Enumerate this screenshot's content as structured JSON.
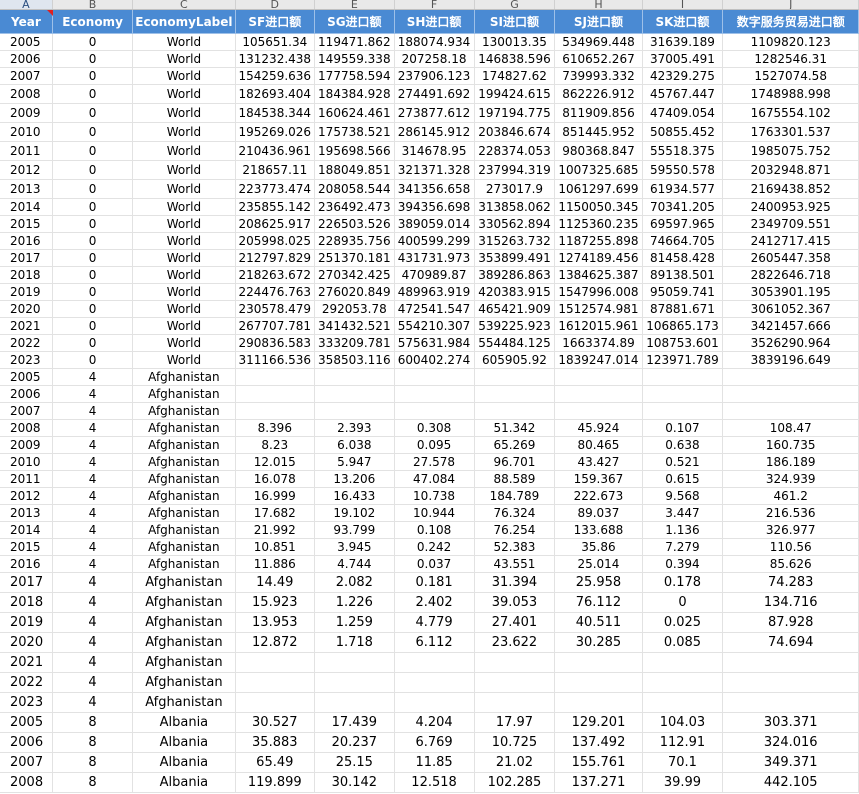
{
  "column_letters": [
    "A",
    "B",
    "C",
    "D",
    "E",
    "F",
    "G",
    "H",
    "I",
    "J"
  ],
  "headers": [
    "Year",
    "Economy",
    "EconomyLabel",
    "SF进口额",
    "SG进口额",
    "SH进口额",
    "SI进口额",
    "SJ进口额",
    "SK进口额",
    "数字服务贸易进口额"
  ],
  "rows": [
    [
      "2005",
      "0",
      "World",
      "105651.34",
      "119471.862",
      "188074.934",
      "130013.35",
      "534969.448",
      "31639.189",
      "1109820.123"
    ],
    [
      "2006",
      "0",
      "World",
      "131232.438",
      "149559.338",
      "207258.18",
      "146838.596",
      "610652.267",
      "37005.491",
      "1282546.31"
    ],
    [
      "2007",
      "0",
      "World",
      "154259.636",
      "177758.594",
      "237906.123",
      "174827.62",
      "739993.332",
      "42329.275",
      "1527074.58"
    ],
    [
      "2008",
      "0",
      "World",
      "182693.404",
      "184384.928",
      "274491.692",
      "199424.615",
      "862226.912",
      "45767.447",
      "1748988.998"
    ],
    [
      "2009",
      "0",
      "World",
      "184538.344",
      "160624.461",
      "273877.612",
      "197194.775",
      "811909.856",
      "47409.054",
      "1675554.102"
    ],
    [
      "2010",
      "0",
      "World",
      "195269.026",
      "175738.521",
      "286145.912",
      "203846.674",
      "851445.952",
      "50855.452",
      "1763301.537"
    ],
    [
      "2011",
      "0",
      "World",
      "210436.961",
      "195698.566",
      "314678.95",
      "228374.053",
      "980368.847",
      "55518.375",
      "1985075.752"
    ],
    [
      "2012",
      "0",
      "World",
      "218657.11",
      "188049.851",
      "321371.328",
      "237994.319",
      "1007325.685",
      "59550.578",
      "2032948.871"
    ],
    [
      "2013",
      "0",
      "World",
      "223773.474",
      "208058.544",
      "341356.658",
      "273017.9",
      "1061297.699",
      "61934.577",
      "2169438.852"
    ],
    [
      "2014",
      "0",
      "World",
      "235855.142",
      "236492.473",
      "394356.698",
      "313858.062",
      "1150050.345",
      "70341.205",
      "2400953.925"
    ],
    [
      "2015",
      "0",
      "World",
      "208625.917",
      "226503.526",
      "389059.014",
      "330562.894",
      "1125360.235",
      "69597.965",
      "2349709.551"
    ],
    [
      "2016",
      "0",
      "World",
      "205998.025",
      "228935.756",
      "400599.299",
      "315263.732",
      "1187255.898",
      "74664.705",
      "2412717.415"
    ],
    [
      "2017",
      "0",
      "World",
      "212797.829",
      "251370.181",
      "431731.973",
      "353899.491",
      "1274189.456",
      "81458.428",
      "2605447.358"
    ],
    [
      "2018",
      "0",
      "World",
      "218263.672",
      "270342.425",
      "470989.87",
      "389286.863",
      "1384625.387",
      "89138.501",
      "2822646.718"
    ],
    [
      "2019",
      "0",
      "World",
      "224476.763",
      "276020.849",
      "489963.919",
      "420383.915",
      "1547996.008",
      "95059.741",
      "3053901.195"
    ],
    [
      "2020",
      "0",
      "World",
      "230578.479",
      "292053.78",
      "472541.547",
      "465421.909",
      "1512574.981",
      "87881.671",
      "3061052.367"
    ],
    [
      "2021",
      "0",
      "World",
      "267707.781",
      "341432.521",
      "554210.307",
      "539225.923",
      "1612015.961",
      "106865.173",
      "3421457.666"
    ],
    [
      "2022",
      "0",
      "World",
      "290836.583",
      "333209.781",
      "575631.984",
      "554484.125",
      "1663374.89",
      "108753.601",
      "3526290.964"
    ],
    [
      "2023",
      "0",
      "World",
      "311166.536",
      "358503.116",
      "600402.274",
      "605905.92",
      "1839247.014",
      "123971.789",
      "3839196.649"
    ],
    [
      "2005",
      "4",
      "Afghanistan",
      "",
      "",
      "",
      "",
      "",
      "",
      ""
    ],
    [
      "2006",
      "4",
      "Afghanistan",
      "",
      "",
      "",
      "",
      "",
      "",
      ""
    ],
    [
      "2007",
      "4",
      "Afghanistan",
      "",
      "",
      "",
      "",
      "",
      "",
      ""
    ],
    [
      "2008",
      "4",
      "Afghanistan",
      "8.396",
      "2.393",
      "0.308",
      "51.342",
      "45.924",
      "0.107",
      "108.47"
    ],
    [
      "2009",
      "4",
      "Afghanistan",
      "8.23",
      "6.038",
      "0.095",
      "65.269",
      "80.465",
      "0.638",
      "160.735"
    ],
    [
      "2010",
      "4",
      "Afghanistan",
      "12.015",
      "5.947",
      "27.578",
      "96.701",
      "43.427",
      "0.521",
      "186.189"
    ],
    [
      "2011",
      "4",
      "Afghanistan",
      "16.078",
      "13.206",
      "47.084",
      "88.589",
      "159.367",
      "0.615",
      "324.939"
    ],
    [
      "2012",
      "4",
      "Afghanistan",
      "16.999",
      "16.433",
      "10.738",
      "184.789",
      "222.673",
      "9.568",
      "461.2"
    ],
    [
      "2013",
      "4",
      "Afghanistan",
      "17.682",
      "19.102",
      "10.944",
      "76.324",
      "89.037",
      "3.447",
      "216.536"
    ],
    [
      "2014",
      "4",
      "Afghanistan",
      "21.992",
      "93.799",
      "0.108",
      "76.254",
      "133.688",
      "1.136",
      "326.977"
    ],
    [
      "2015",
      "4",
      "Afghanistan",
      "10.851",
      "3.945",
      "0.242",
      "52.383",
      "35.86",
      "7.279",
      "110.56"
    ],
    [
      "2016",
      "4",
      "Afghanistan",
      "11.886",
      "4.744",
      "0.037",
      "43.551",
      "25.014",
      "0.394",
      "85.626"
    ],
    [
      "2017",
      "4",
      "Afghanistan",
      "14.49",
      "2.082",
      "0.181",
      "31.394",
      "25.958",
      "0.178",
      "74.283"
    ],
    [
      "2018",
      "4",
      "Afghanistan",
      "15.923",
      "1.226",
      "2.402",
      "39.053",
      "76.112",
      "0",
      "134.716"
    ],
    [
      "2019",
      "4",
      "Afghanistan",
      "13.953",
      "1.259",
      "4.779",
      "27.401",
      "40.511",
      "0.025",
      "87.928"
    ],
    [
      "2020",
      "4",
      "Afghanistan",
      "12.872",
      "1.718",
      "6.112",
      "23.622",
      "30.285",
      "0.085",
      "74.694"
    ],
    [
      "2021",
      "4",
      "Afghanistan",
      "",
      "",
      "",
      "",
      "",
      "",
      ""
    ],
    [
      "2022",
      "4",
      "Afghanistan",
      "",
      "",
      "",
      "",
      "",
      "",
      ""
    ],
    [
      "2023",
      "4",
      "Afghanistan",
      "",
      "",
      "",
      "",
      "",
      "",
      ""
    ],
    [
      "2005",
      "8",
      "Albania",
      "30.527",
      "17.439",
      "4.204",
      "17.97",
      "129.201",
      "104.03",
      "303.371"
    ],
    [
      "2006",
      "8",
      "Albania",
      "35.883",
      "20.237",
      "6.769",
      "10.725",
      "137.492",
      "112.91",
      "324.016"
    ],
    [
      "2007",
      "8",
      "Albania",
      "65.49",
      "25.15",
      "11.85",
      "21.02",
      "155.761",
      "70.1",
      "349.371"
    ],
    [
      "2008",
      "8",
      "Albania",
      "119.899",
      "30.142",
      "12.518",
      "102.285",
      "137.271",
      "39.99",
      "442.105"
    ]
  ]
}
